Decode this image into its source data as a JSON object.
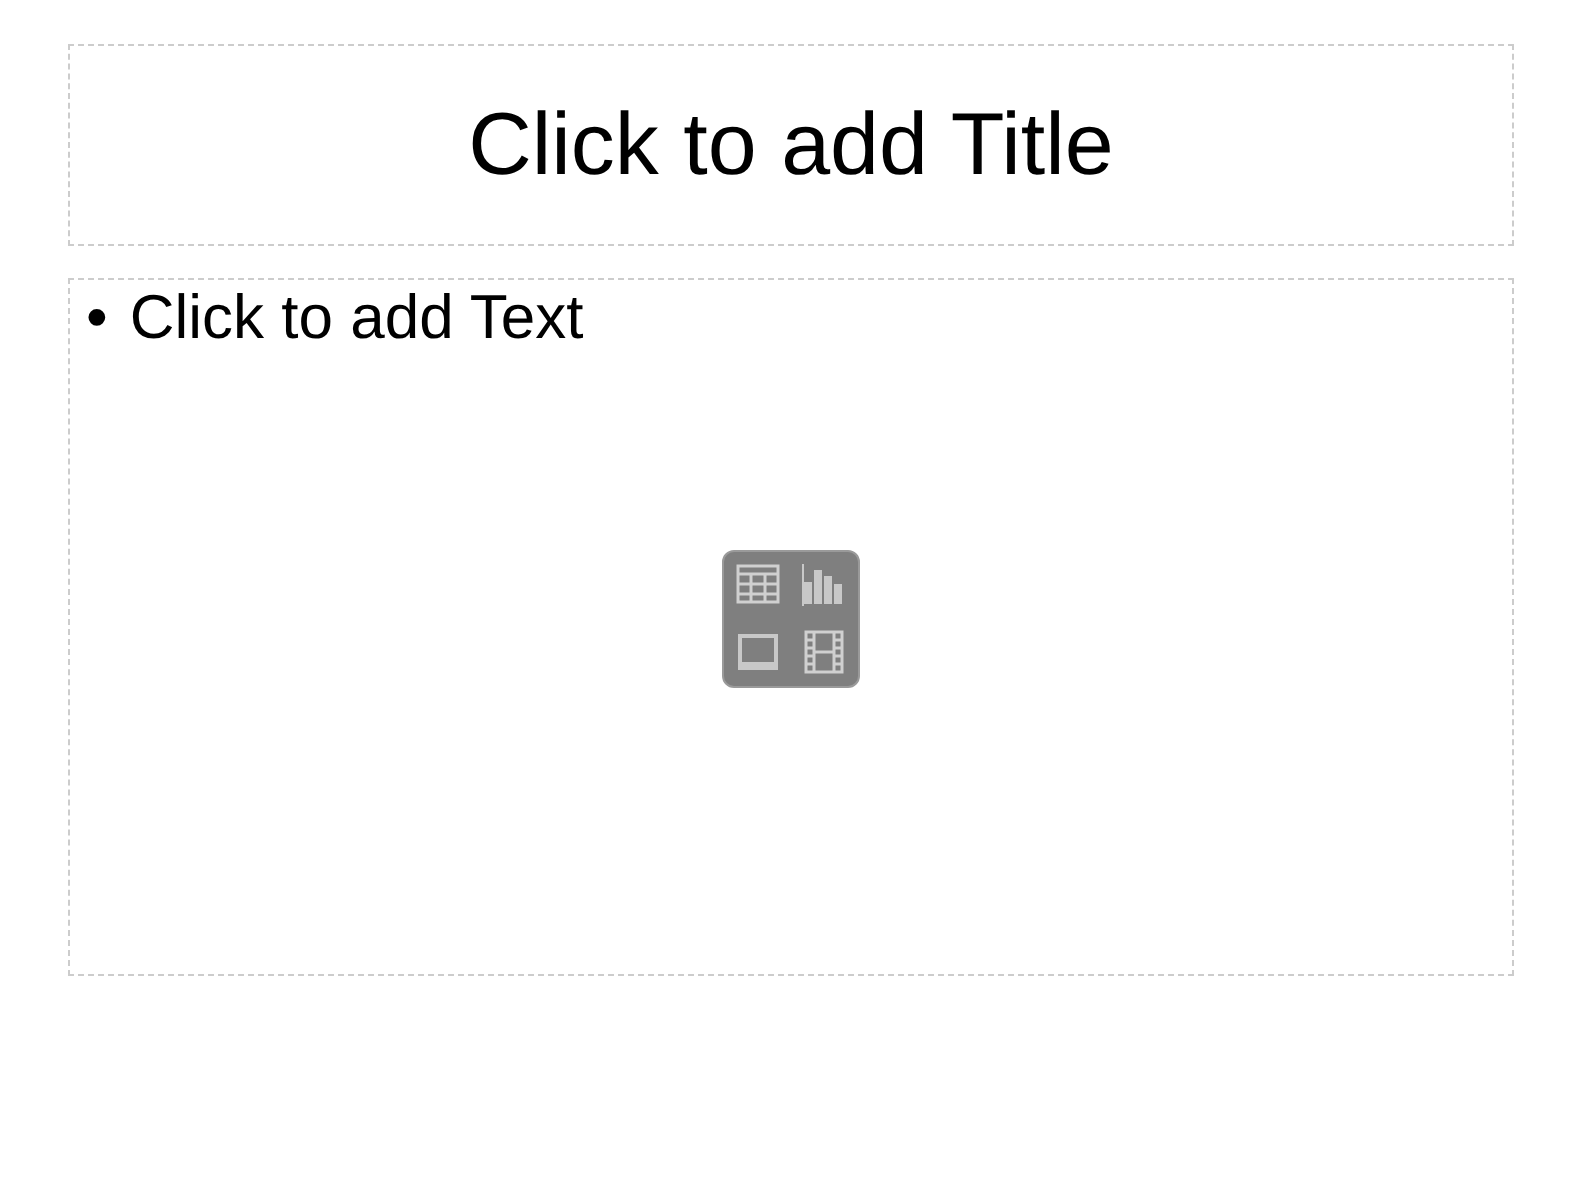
{
  "title_placeholder": {
    "text": "Click to add Title"
  },
  "content_placeholder": {
    "bullet": "•",
    "text": "Click to add Text"
  }
}
